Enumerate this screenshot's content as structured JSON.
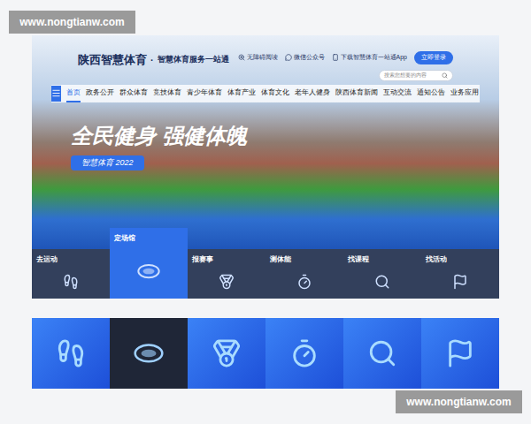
{
  "watermarks": [
    "www.nongtianw.com",
    "www.nongtianw.com"
  ],
  "header": {
    "logo": "陕西智慧体育",
    "separator": "·",
    "tagline": "智慧体育服务一站通",
    "links": [
      "无障碍阅读",
      "微信公众号",
      "下载智慧体育一站通App"
    ],
    "login": "立即登录",
    "search_placeholder": "搜索您想要的内容"
  },
  "nav": [
    {
      "label": "首页",
      "selected": true
    },
    {
      "label": "政务公开",
      "selected": false
    },
    {
      "label": "群众体育",
      "selected": false
    },
    {
      "label": "竞技体育",
      "selected": false
    },
    {
      "label": "青少年体育",
      "selected": false
    },
    {
      "label": "体育产业",
      "selected": false
    },
    {
      "label": "体育文化",
      "selected": false
    },
    {
      "label": "老年人健身",
      "selected": false
    },
    {
      "label": "陕西体育新闻",
      "selected": false
    },
    {
      "label": "互动交流",
      "selected": false
    },
    {
      "label": "通知公告",
      "selected": false
    },
    {
      "label": "业务应用",
      "selected": false
    }
  ],
  "hero": {
    "title": "全民健身 强健体魄",
    "badge": "智慧体育 2022"
  },
  "tiles": [
    {
      "label": "去运动",
      "selected": false
    },
    {
      "label": "定场馆",
      "selected": true
    },
    {
      "label": "报赛事",
      "selected": false
    },
    {
      "label": "测体能",
      "selected": false
    },
    {
      "label": "找课程",
      "selected": false
    },
    {
      "label": "找活动",
      "selected": false
    }
  ],
  "icon_strip": [
    {
      "selected": false
    },
    {
      "selected": true
    },
    {
      "selected": false
    },
    {
      "selected": false
    },
    {
      "selected": false
    },
    {
      "selected": false
    }
  ]
}
